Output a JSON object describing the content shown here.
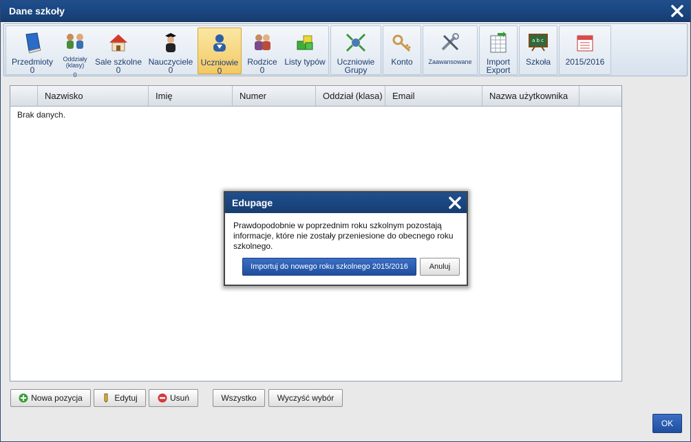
{
  "window": {
    "title": "Dane szkoły"
  },
  "toolbar": {
    "items": [
      {
        "label": "Przedmioty",
        "count": "0",
        "icon": "book-icon"
      },
      {
        "label": "Oddziały (klasy)",
        "count": "0",
        "icon": "classes-icon"
      },
      {
        "label": "Sale szkolne",
        "count": "0",
        "icon": "classroom-icon"
      },
      {
        "label": "Nauczyciele",
        "count": "0",
        "icon": "teacher-icon"
      },
      {
        "label": "Uczniowie",
        "count": "0",
        "icon": "student-icon"
      },
      {
        "label": "Rodzice",
        "count": "0",
        "icon": "parents-icon"
      },
      {
        "label": "Listy typów",
        "icon": "types-list-icon"
      },
      {
        "label": "Uczniowie",
        "label2": "Grupy",
        "icon": "student-groups-icon"
      },
      {
        "label": "Konto",
        "icon": "account-icon"
      },
      {
        "label": "Zaawansowane",
        "icon": "tools-icon"
      },
      {
        "label": "Import",
        "label2": "Export",
        "icon": "import-export-icon"
      },
      {
        "label": "Szkoła",
        "icon": "school-board-icon"
      },
      {
        "label": "2015/2016",
        "icon": "calendar-icon"
      }
    ]
  },
  "grid": {
    "columns": [
      "",
      "Nazwisko",
      "Imię",
      "Numer",
      "Oddział (klasa)",
      "Email",
      "Nazwa użytkownika"
    ],
    "empty_message": "Brak danych."
  },
  "actions": {
    "new_item": "Nowa pozycja",
    "edit": "Edytuj",
    "delete": "Usuń",
    "all": "Wszystko",
    "clear_selection": "Wyczyść wybór",
    "ok": "OK"
  },
  "dialog": {
    "title": "Edupage",
    "message": "Prawdopodobnie w poprzednim roku szkolnym pozostają informacje, które nie zostały przeniesione do obecnego roku szkolnego.",
    "primary_button": "Importuj do nowego roku szkolnego 2015/2016",
    "cancel_button": "Anuluj"
  },
  "colors": {
    "titlebar": "#1f4f8f",
    "selected_tab": "#f2c965",
    "primary_button": "#2a5db0"
  }
}
